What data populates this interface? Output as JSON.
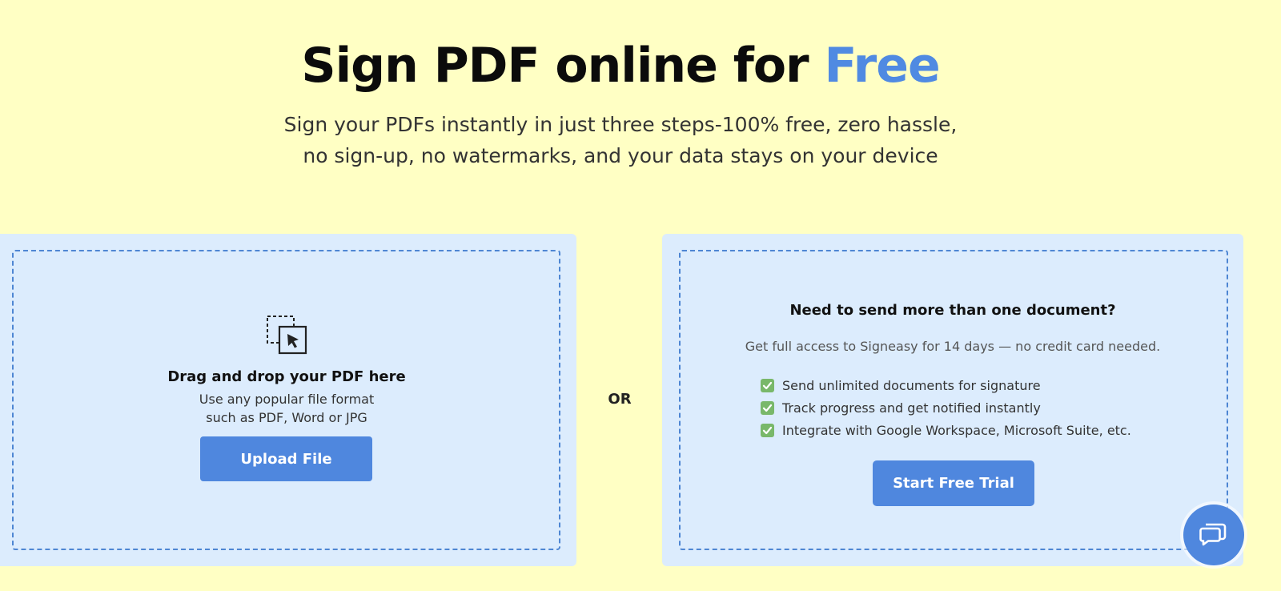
{
  "hero": {
    "title_main": "Sign PDF online for ",
    "title_accent": "Free",
    "subtitle_line1": "Sign your PDFs instantly in just three steps-100% free, zero hassle,",
    "subtitle_line2": "no sign-up, no watermarks, and your data stays on your device"
  },
  "upload": {
    "icon": "drag-drop-cursor-icon",
    "title": "Drag and drop your PDF here",
    "sub_line1": "Use any popular file format",
    "sub_line2": "such as PDF, Word or JPG",
    "button_label": "Upload File"
  },
  "divider": {
    "label": "OR"
  },
  "trial": {
    "title": "Need to send more than one document?",
    "subtitle": "Get full access to Signeasy for 14 days — no credit card needed.",
    "features": [
      "Send unlimited documents for signature",
      "Track progress and get notified instantly",
      "Integrate with Google Workspace, Microsoft Suite, etc."
    ],
    "button_label": "Start Free Trial"
  },
  "chat": {
    "icon": "chat-bubbles-icon"
  },
  "colors": {
    "background": "#ffffc4",
    "card": "#dcecfd",
    "accent": "#508ae2",
    "button": "#4f87de",
    "check": "#79b86a"
  }
}
